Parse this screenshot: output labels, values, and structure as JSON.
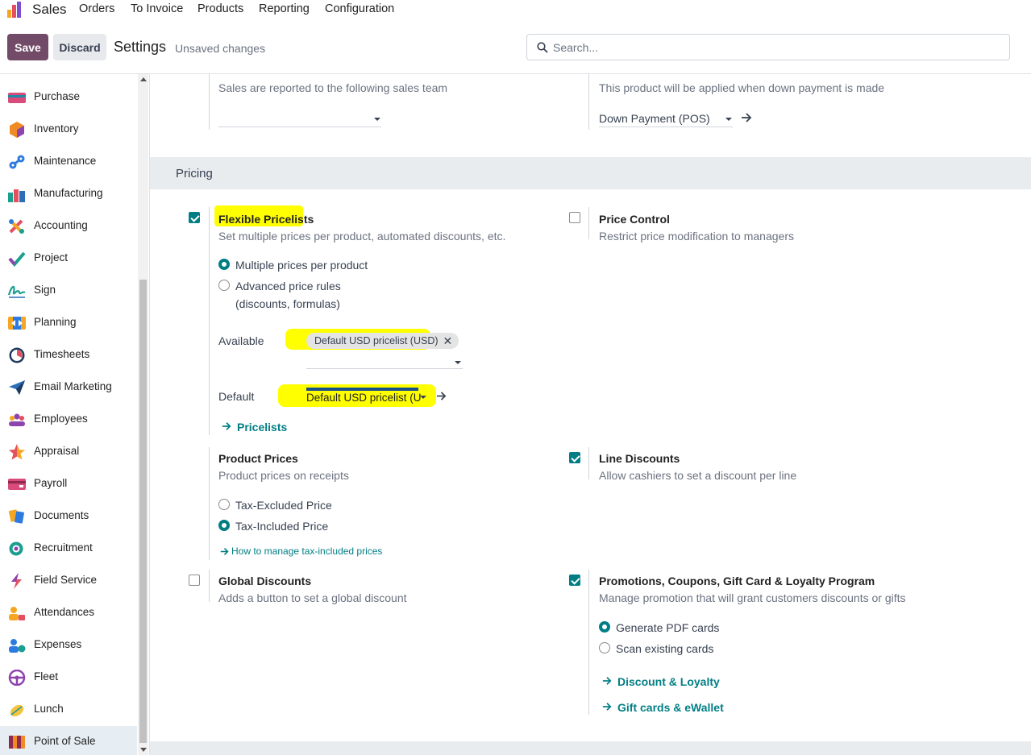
{
  "topnav": {
    "app_name": "Sales",
    "menus": [
      "Orders",
      "To Invoice",
      "Products",
      "Reporting",
      "Configuration"
    ]
  },
  "controlbar": {
    "save_label": "Save",
    "discard_label": "Discard",
    "breadcrumb": "Settings",
    "status": "Unsaved changes",
    "search_placeholder": "Search..."
  },
  "sidebar": {
    "items": [
      {
        "label": "Purchase",
        "icon": "purchase-icon"
      },
      {
        "label": "Inventory",
        "icon": "inventory-icon"
      },
      {
        "label": "Maintenance",
        "icon": "maintenance-icon"
      },
      {
        "label": "Manufacturing",
        "icon": "manufacturing-icon"
      },
      {
        "label": "Accounting",
        "icon": "accounting-icon"
      },
      {
        "label": "Project",
        "icon": "project-icon"
      },
      {
        "label": "Sign",
        "icon": "sign-icon"
      },
      {
        "label": "Planning",
        "icon": "planning-icon"
      },
      {
        "label": "Timesheets",
        "icon": "timesheets-icon"
      },
      {
        "label": "Email Marketing",
        "icon": "email-marketing-icon"
      },
      {
        "label": "Employees",
        "icon": "employees-icon"
      },
      {
        "label": "Appraisal",
        "icon": "appraisal-icon"
      },
      {
        "label": "Payroll",
        "icon": "payroll-icon"
      },
      {
        "label": "Documents",
        "icon": "documents-icon"
      },
      {
        "label": "Recruitment",
        "icon": "recruitment-icon"
      },
      {
        "label": "Field Service",
        "icon": "field-service-icon"
      },
      {
        "label": "Attendances",
        "icon": "attendances-icon"
      },
      {
        "label": "Expenses",
        "icon": "expenses-icon"
      },
      {
        "label": "Fleet",
        "icon": "fleet-icon"
      },
      {
        "label": "Lunch",
        "icon": "lunch-icon"
      },
      {
        "label": "Point of Sale",
        "icon": "point-of-sale-icon",
        "active": true
      }
    ]
  },
  "top_fields": {
    "sales_team_desc": "Sales are reported to the following sales team",
    "down_payment_desc": "This product will be applied when down payment is made",
    "down_payment_value": "Down Payment (POS)"
  },
  "pricing": {
    "section_title": "Pricing",
    "flexible_pricelists": {
      "title": "Flexible Pricelists",
      "desc": "Set multiple prices per product, automated discounts, etc.",
      "checked": true,
      "option1": "Multiple prices per product",
      "option2_line1": "Advanced price rules",
      "option2_line2": "(discounts, formulas)",
      "available_label": "Available",
      "available_tag": "Default USD pricelist (USD)",
      "default_label": "Default",
      "default_value": "Default USD pricelist (U",
      "pricelists_link": "Pricelists"
    },
    "price_control": {
      "title": "Price Control",
      "desc": "Restrict price modification to managers",
      "checked": false
    },
    "product_prices": {
      "title": "Product Prices",
      "desc": "Product prices on receipts",
      "option1": "Tax-Excluded Price",
      "option2": "Tax-Included Price",
      "link": "How to manage tax-included prices"
    },
    "line_discounts": {
      "title": "Line Discounts",
      "desc": "Allow cashiers to set a discount per line",
      "checked": true
    },
    "global_discounts": {
      "title": "Global Discounts",
      "desc": "Adds a button to set a global discount",
      "checked": false
    },
    "promotions": {
      "title": "Promotions, Coupons, Gift Card & Loyalty Program",
      "desc": "Manage promotion that will grant customers discounts or gifts",
      "checked": true,
      "option1": "Generate PDF cards",
      "option2": "Scan existing cards",
      "link1": "Discount & Loyalty",
      "link2": "Gift cards & eWallet"
    }
  }
}
